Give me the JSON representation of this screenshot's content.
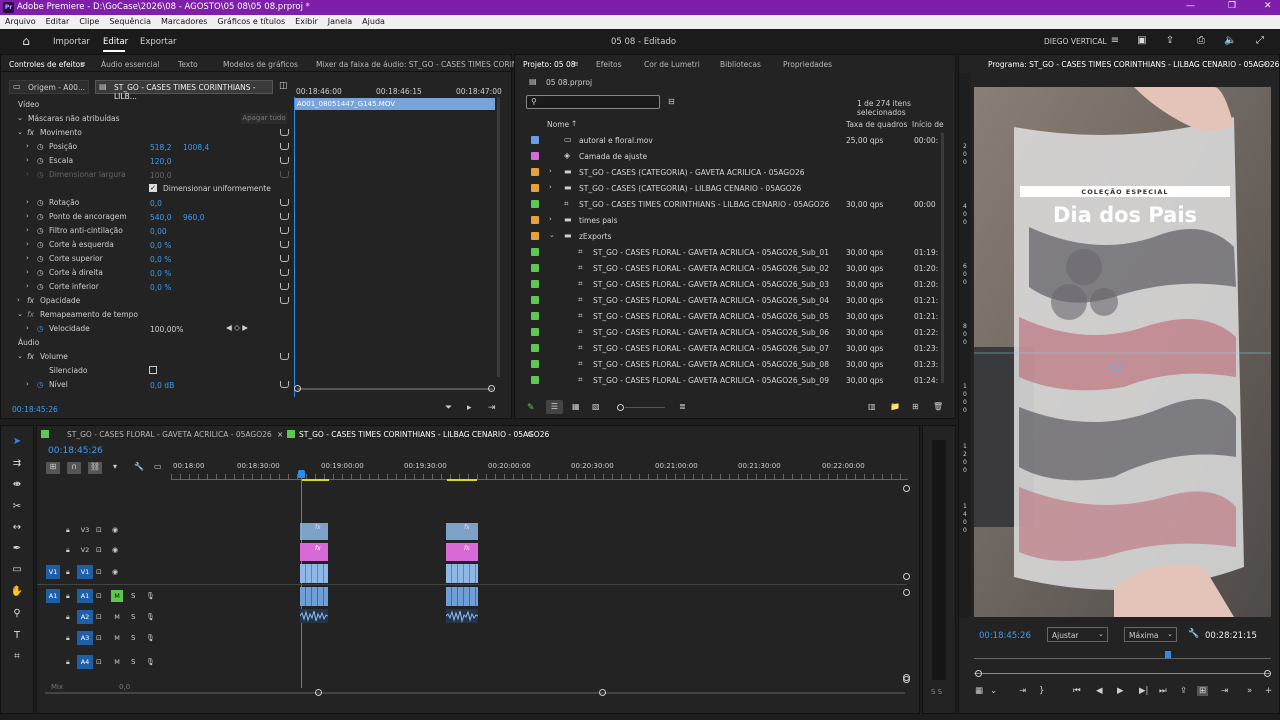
{
  "window": {
    "title": "Adobe Premiere - D:\\GoCase\\2026\\08 - AGOSTO\\05 08\\05 08.prproj *",
    "app_badge": "Pr"
  },
  "menu": [
    "Arquivo",
    "Editar",
    "Clipe",
    "Sequência",
    "Marcadores",
    "Gráficos e títulos",
    "Exibir",
    "Janela",
    "Ajuda"
  ],
  "header": {
    "nav": [
      "Importar",
      "Editar",
      "Exportar"
    ],
    "active": "Editar",
    "center_title": "05 08 - Editado",
    "workspace": "DIEGO VERTICAL"
  },
  "effect_controls": {
    "tabs": [
      "Controles de efeitos",
      "Áudio essencial",
      "Texto",
      "Modelos de gráficos",
      "Mixer da faixa de áudio: ST_GO - CASES TIMES CORINTHI"
    ],
    "source_tab": "Origem - A00...",
    "seq_tab": "ST_GO - CASES TIMES CORINTHIANS - LILB...",
    "ruler": [
      "00:18:46:00",
      "00:18:46:15",
      "00:18:47:00"
    ],
    "clip_name": "A001_08051447_G145.MOV",
    "video_label": "Vídeo",
    "masks_label": "Máscaras não atribuídas",
    "delete_all": "Apagar tudo",
    "motion": "Movimento",
    "props": [
      {
        "name": "Posição",
        "v1": "518,2",
        "v2": "1008,4"
      },
      {
        "name": "Escala",
        "v1": "120,0",
        "v2": ""
      },
      {
        "name": "Dimensionar largura",
        "v1": "100,0",
        "v2": ""
      },
      {
        "name": "Dimensionar uniformemente",
        "v1": "",
        "v2": ""
      },
      {
        "name": "Rotação",
        "v1": "0,0",
        "v2": ""
      },
      {
        "name": "Ponto de ancoragem",
        "v1": "540,0",
        "v2": "960,0"
      },
      {
        "name": "Filtro anti-cintilação",
        "v1": "0,00",
        "v2": ""
      },
      {
        "name": "Corte à esquerda",
        "v1": "0,0 %",
        "v2": ""
      },
      {
        "name": "Corte superior",
        "v1": "0,0 %",
        "v2": ""
      },
      {
        "name": "Corte à direita",
        "v1": "0,0 %",
        "v2": ""
      },
      {
        "name": "Corte inferior",
        "v1": "0,0 %",
        "v2": ""
      }
    ],
    "opacity": "Opacidade",
    "time_remap": "Remapeamento de tempo",
    "speed_label": "Velocidade",
    "speed": "100,00%",
    "audio_label": "Áudio",
    "volume": "Volume",
    "mute_label": "Silenciado",
    "level_label": "Nível",
    "level": "0,0 dB",
    "timecode": "00:18:45:26"
  },
  "project": {
    "tabs": [
      "Projeto: 05 08",
      "Efeitos",
      "Cor de Lumetri",
      "Bibliotecas",
      "Propriedades"
    ],
    "file": "05 08.prproj",
    "selected_count": "1 de 274 itens selecionados",
    "columns": {
      "name": "Nome",
      "fps": "Taxa de quadros",
      "start": "Início de"
    },
    "items": [
      {
        "name": "autoral e floral.mov",
        "fps": "25,00 qps",
        "start": "00:00:",
        "color": "#6a9be8",
        "icon": "clip"
      },
      {
        "name": "Camada de ajuste",
        "fps": "",
        "start": "",
        "color": "#d86ad8",
        "icon": "adj"
      },
      {
        "name": "ST_GO - CASES (CATEGORIA) - GAVETA ACRILICA - 05AGO26",
        "fps": "",
        "start": "",
        "color": "#e8a13a",
        "icon": "folder"
      },
      {
        "name": "ST_GO - CASES (CATEGORIA) - LILBAG CENARIO - 05AGO26",
        "fps": "",
        "start": "",
        "color": "#e8a13a",
        "icon": "folder"
      },
      {
        "name": "ST_GO - CASES TIMES CORINTHIANS - LILBAG CENARIO - 05AGO26",
        "fps": "30,00 qps",
        "start": "00:00",
        "color": "#5fc852",
        "icon": "seq"
      },
      {
        "name": "times pais",
        "fps": "",
        "start": "",
        "color": "#e8a13a",
        "icon": "folder"
      },
      {
        "name": "zExports",
        "fps": "",
        "start": "",
        "color": "#e8a13a",
        "icon": "folder"
      },
      {
        "name": "ST_GO - CASES FLORAL - GAVETA ACRILICA - 05AGO26_Sub_01",
        "fps": "30,00 qps",
        "start": "01:19:",
        "color": "#5fc852",
        "icon": "seq"
      },
      {
        "name": "ST_GO - CASES FLORAL - GAVETA ACRILICA - 05AGO26_Sub_02",
        "fps": "30,00 qps",
        "start": "01:20:",
        "color": "#5fc852",
        "icon": "seq"
      },
      {
        "name": "ST_GO - CASES FLORAL - GAVETA ACRILICA - 05AGO26_Sub_03",
        "fps": "30,00 qps",
        "start": "01:20:",
        "color": "#5fc852",
        "icon": "seq"
      },
      {
        "name": "ST_GO - CASES FLORAL - GAVETA ACRILICA - 05AGO26_Sub_04",
        "fps": "30,00 qps",
        "start": "01:21:",
        "color": "#5fc852",
        "icon": "seq"
      },
      {
        "name": "ST_GO - CASES FLORAL - GAVETA ACRILICA - 05AGO26_Sub_05",
        "fps": "30,00 qps",
        "start": "01:21:",
        "color": "#5fc852",
        "icon": "seq"
      },
      {
        "name": "ST_GO - CASES FLORAL - GAVETA ACRILICA - 05AGO26_Sub_06",
        "fps": "30,00 qps",
        "start": "01:22:",
        "color": "#5fc852",
        "icon": "seq"
      },
      {
        "name": "ST_GO - CASES FLORAL - GAVETA ACRILICA - 05AGO26_Sub_07",
        "fps": "30,00 qps",
        "start": "01:23:",
        "color": "#5fc852",
        "icon": "seq"
      },
      {
        "name": "ST_GO - CASES FLORAL - GAVETA ACRILICA - 05AGO26_Sub_08",
        "fps": "30,00 qps",
        "start": "01:23:",
        "color": "#5fc852",
        "icon": "seq"
      },
      {
        "name": "ST_GO - CASES FLORAL - GAVETA ACRILICA - 05AGO26_Sub_09",
        "fps": "30,00 qps",
        "start": "01:24:",
        "color": "#5fc852",
        "icon": "seq"
      }
    ]
  },
  "program": {
    "title": "Programa: ST_GO - CASES TIMES CORINTHIANS - LILBAG CENARIO - 05AGO26",
    "overlay_small": "COLEÇÃO ESPECIAL",
    "overlay_big": "Dia dos Pais",
    "timecode": "00:18:45:26",
    "fit": "Ajustar",
    "quality": "Máxima",
    "duration": "00:28:21:15"
  },
  "timeline": {
    "tabs": [
      "ST_GO - CASES FLORAL - GAVETA ACRILICA - 05AGO26",
      "ST_GO - CASES TIMES CORINTHIANS - LILBAG CENARIO - 05AGO26"
    ],
    "timecode": "00:18:45:26",
    "ruler": [
      "00:18:00",
      "00:18:30:00",
      "00:19:00:00",
      "00:19:30:00",
      "00:20:00:00",
      "00:20:30:00",
      "00:21:00:00",
      "00:21:30:00",
      "00:22:00:00"
    ],
    "video_tracks": [
      "V3",
      "V2",
      "V1"
    ],
    "audio_tracks": [
      "A1",
      "A2",
      "A3",
      "A4"
    ],
    "source_v": "V1",
    "source_a": "A1",
    "mix_label": "Mix",
    "mix_value": "0,0",
    "clip_fx": "fx"
  },
  "colors": {
    "accent": "#2d8ceb",
    "title_bar": "#7d1faa",
    "adj_clip": "#d86ad8",
    "video_clip": "#8fb8e6",
    "audio_clip": "#6e9fd6"
  }
}
